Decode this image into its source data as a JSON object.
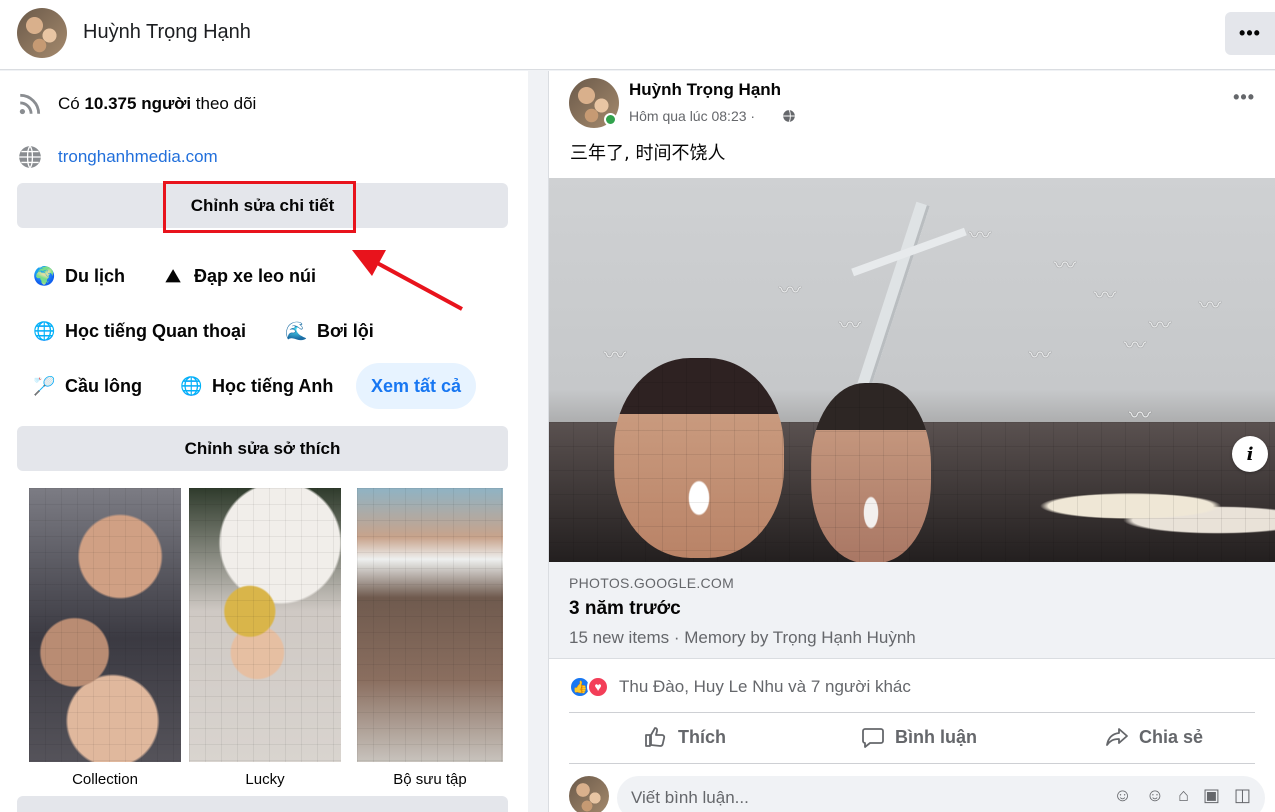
{
  "header": {
    "profile_name": "Huỳnh Trọng Hạnh",
    "more_label": "•••"
  },
  "intro": {
    "followers_prefix": "Có ",
    "followers_count": "10.375 người",
    "followers_suffix": " theo dõi",
    "website": "tronghanhmedia.com",
    "edit_details_label": "Chỉnh sửa chi tiết",
    "hobbies": [
      {
        "icon": "🌍",
        "label": "Du lịch"
      },
      {
        "icon": "⛰",
        "label": "Đạp xe leo núi"
      },
      {
        "icon": "🌐",
        "label": "Học tiếng Quan thoại"
      },
      {
        "icon": "🌊",
        "label": "Bơi lội"
      },
      {
        "icon": "🏸",
        "label": "Cầu lông"
      },
      {
        "icon": "🌐",
        "label": "Học tiếng Anh"
      }
    ],
    "see_all_label": "Xem tất cả",
    "edit_hobbies_label": "Chỉnh sửa sở thích",
    "collections": [
      "Collection",
      "Lucky",
      "Bộ sưu tập"
    ]
  },
  "post": {
    "author": "Huỳnh Trọng Hạnh",
    "time": "Hôm qua lúc 08:23 · ",
    "more_label": "•••",
    "text": "三年了, 时间不饶人",
    "link": {
      "domain": "PHOTOS.GOOGLE.COM",
      "title": "3 năm trước",
      "subtitle": "15 new items · Memory by Trọng Hạnh Huỳnh"
    },
    "reactors": "Thu Đào, Huy Le Nhu và 7 người khác",
    "actions": {
      "like": "Thích",
      "comment": "Bình luận",
      "share": "Chia sẻ"
    },
    "comment_placeholder": "Viết bình luận..."
  },
  "colors": {
    "accent": "#1877f2",
    "annotation_red": "#e8131c",
    "link_blue": "#216fdb",
    "online_green": "#31a24c"
  }
}
